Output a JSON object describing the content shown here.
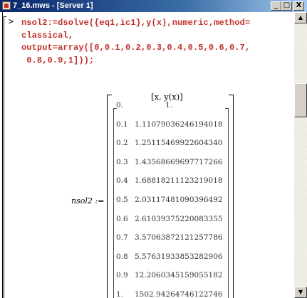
{
  "window": {
    "title": "7_16.mws - [Server 1]",
    "min_label": "_",
    "max_label": "□",
    "close_label": "X"
  },
  "input": {
    "prompt": ">",
    "lines": [
      "nsol2:=dsolve({eq1,ic1},y(x),numeric,method=",
      "classical,",
      "output=array([0,0.1,0.2,0.3,0.4,0.5,0.6,0.7,",
      " 0.8,0.9,1]));"
    ]
  },
  "output": {
    "label": "nsol2 :=",
    "header": "[x, y(x)]",
    "rows": [
      {
        "x": "0.",
        "y": "1."
      },
      {
        "x": "0.1",
        "y": "1.1107903624619401​8"
      },
      {
        "x": "0.2",
        "y": "1.25115469922604340"
      },
      {
        "x": "0.3",
        "y": "1.43568669697717266"
      },
      {
        "x": "0.4",
        "y": "1.68818211123219018"
      },
      {
        "x": "0.5",
        "y": "2.03117481090396492"
      },
      {
        "x": "0.6",
        "y": "2.61039375220083355"
      },
      {
        "x": "0.7",
        "y": "3.57063872121257786"
      },
      {
        "x": "0.8",
        "y": "5.57631933853282906"
      },
      {
        "x": "0.9",
        "y": "12.2060345159055182"
      },
      {
        "x": "1.",
        "y": "1502.94264746122746"
      }
    ]
  },
  "scrollbar": {
    "up_label": "▲",
    "down_label": "▼"
  }
}
